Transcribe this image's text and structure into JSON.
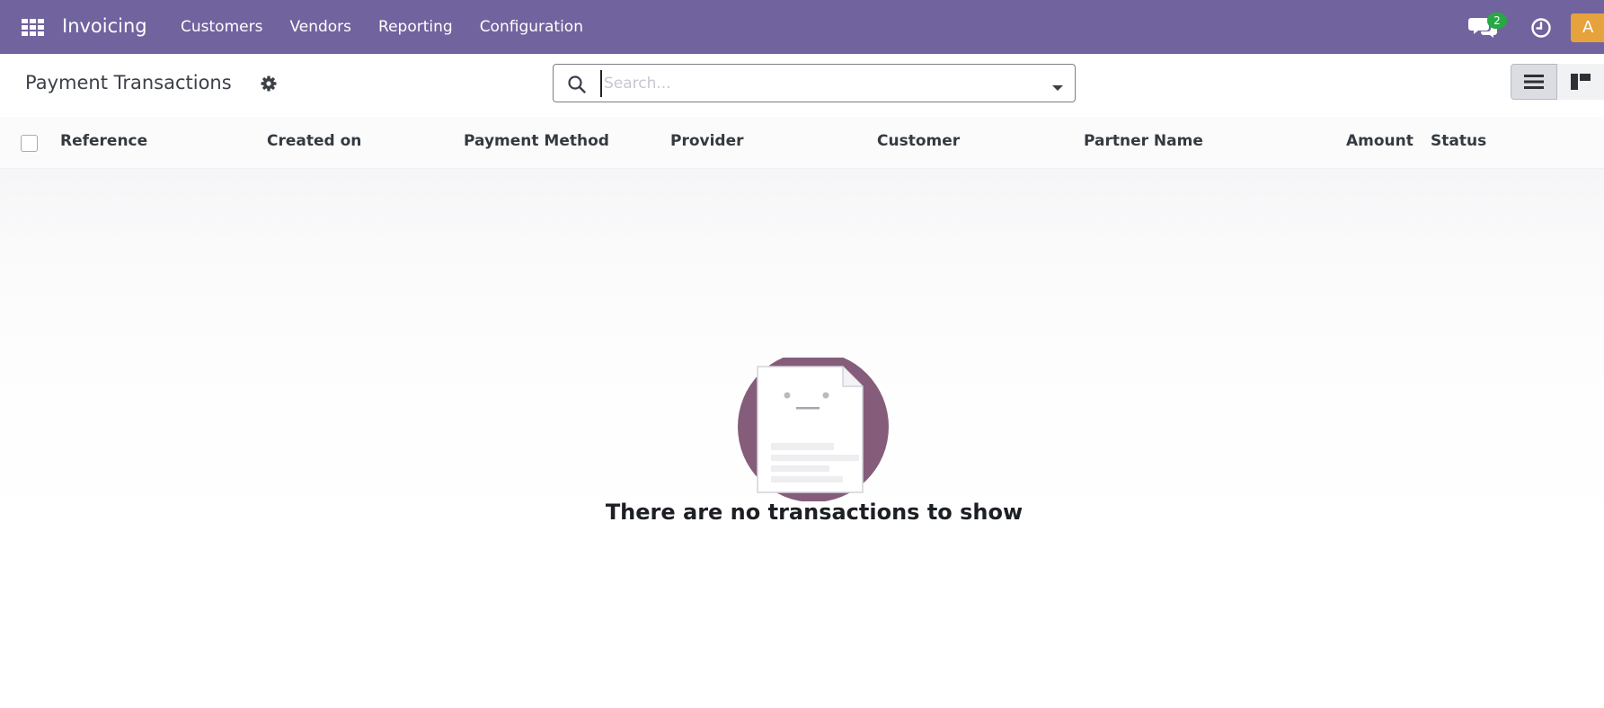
{
  "navbar": {
    "app_name": "Invoicing",
    "menu": [
      {
        "label": "Customers"
      },
      {
        "label": "Vendors"
      },
      {
        "label": "Reporting"
      },
      {
        "label": "Configuration"
      }
    ],
    "chat_badge_count": "2",
    "user_initial": "A"
  },
  "control_panel": {
    "title": "Payment Transactions",
    "search_placeholder": "Search...",
    "views": [
      "list-view",
      "kanban-view"
    ],
    "active_view": "list-view"
  },
  "list": {
    "columns": [
      {
        "label": "Reference"
      },
      {
        "label": "Created on"
      },
      {
        "label": "Payment Method"
      },
      {
        "label": "Provider"
      },
      {
        "label": "Customer"
      },
      {
        "label": "Partner Name"
      },
      {
        "label": "Amount"
      },
      {
        "label": "Status"
      }
    ],
    "rows": []
  },
  "empty_state": {
    "message": "There are no transactions to show"
  },
  "colors": {
    "navbar": "#71639e",
    "badge": "#28a745",
    "avatar": "#e6a23c",
    "illustration_circle": "#7b4e6f"
  }
}
